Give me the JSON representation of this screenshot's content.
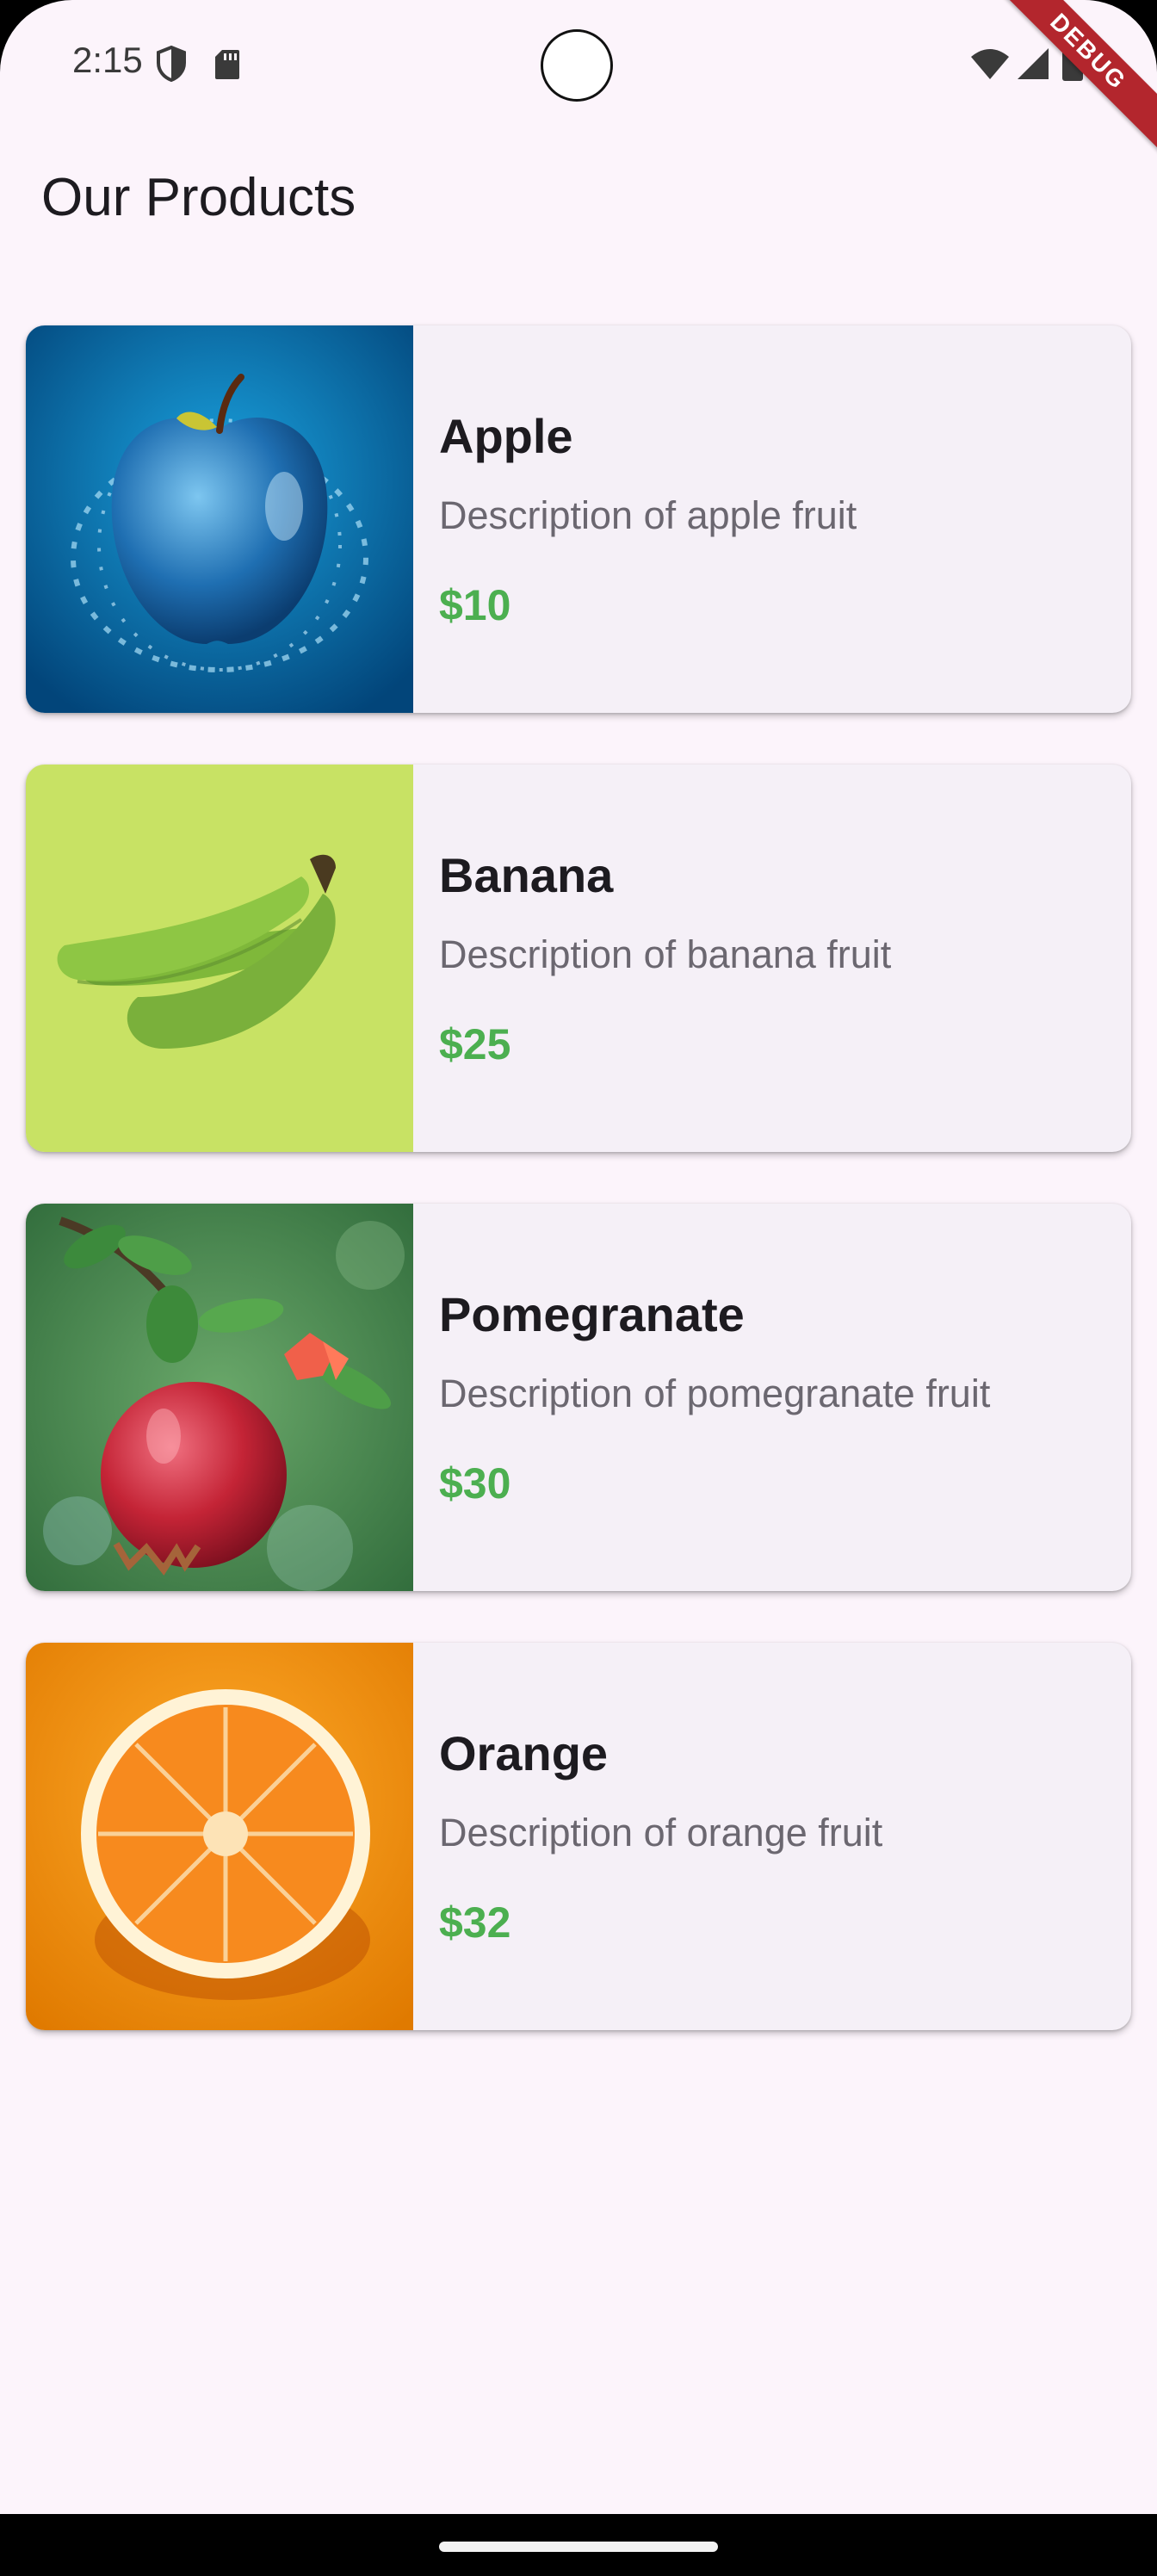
{
  "status_bar": {
    "time": "2:15",
    "icons": [
      "shield-icon",
      "sd-card-icon",
      "wifi-icon",
      "signal-icon",
      "battery-icon"
    ],
    "debug_label": "DEBUG"
  },
  "page": {
    "title": "Our Products"
  },
  "products": [
    {
      "name": "Apple",
      "description": "Description of apple fruit",
      "price": "$10",
      "image": "apple-image"
    },
    {
      "name": "Banana",
      "description": "Description of banana fruit",
      "price": "$25",
      "image": "banana-image"
    },
    {
      "name": "Pomegranate",
      "description": "Description of pomegranate fruit",
      "price": "$30",
      "image": "pomegranate-image"
    },
    {
      "name": "Orange",
      "description": "Description of orange fruit",
      "price": "$32",
      "image": "orange-image"
    }
  ],
  "colors": {
    "background": "#fcf4fb",
    "card": "#f5f0f7",
    "price": "#4caf50",
    "debug_ribbon": "#b3262d"
  }
}
